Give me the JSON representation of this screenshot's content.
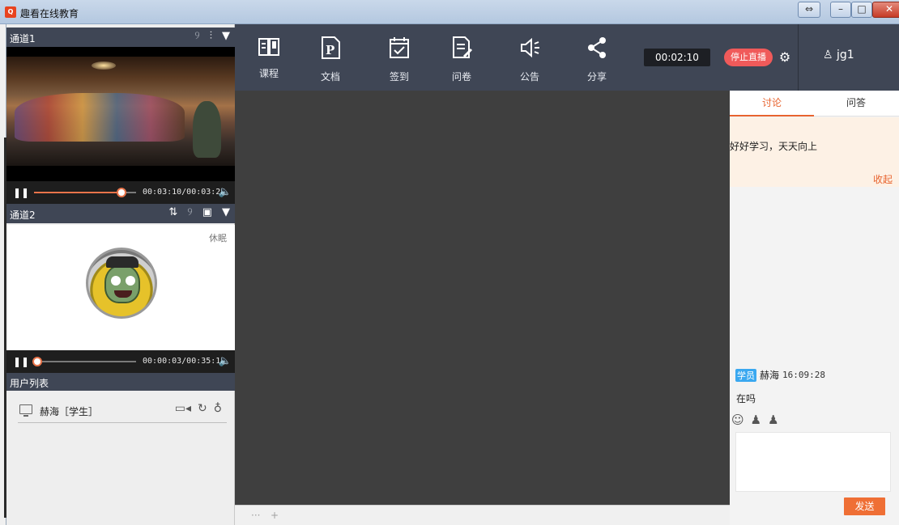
{
  "window": {
    "title": "趣看在线教育",
    "logo_text": "Q"
  },
  "channel1": {
    "label": "通道1",
    "time": "00:03:10/00:03:28",
    "progress": 0.86
  },
  "channel2": {
    "label": "通道2",
    "tag": "休眠",
    "time": "00:00:03/00:35:11",
    "progress": 0.03
  },
  "userlist": {
    "label": "用户列表",
    "users": [
      {
        "name": "赫海［学生］"
      }
    ]
  },
  "toolbar": {
    "items": [
      {
        "label": "课程",
        "icon": "book-icon"
      },
      {
        "label": "文档",
        "icon": "document-p-icon"
      },
      {
        "label": "签到",
        "icon": "calendar-check-icon"
      },
      {
        "label": "问卷",
        "icon": "questionnaire-icon"
      },
      {
        "label": "公告",
        "icon": "megaphone-icon"
      },
      {
        "label": "分享",
        "icon": "share-icon"
      }
    ],
    "clock": "00:02:10",
    "stop_live": "停止直播"
  },
  "user": {
    "name": "jg1"
  },
  "right": {
    "tabs": [
      {
        "label": "讨论"
      },
      {
        "label": "问答"
      }
    ],
    "notice": "好好学习，天天向上",
    "collapse": "收起",
    "message": {
      "role": "学员",
      "sender": "赫海",
      "time": "16:09:28",
      "text": "在吗"
    },
    "send": "发送"
  },
  "colors": {
    "accent": "#e8632e",
    "toolbar_bg": "#3f4655",
    "stop_live": "#f05a5a",
    "role_badge": "#3aa8f0"
  }
}
